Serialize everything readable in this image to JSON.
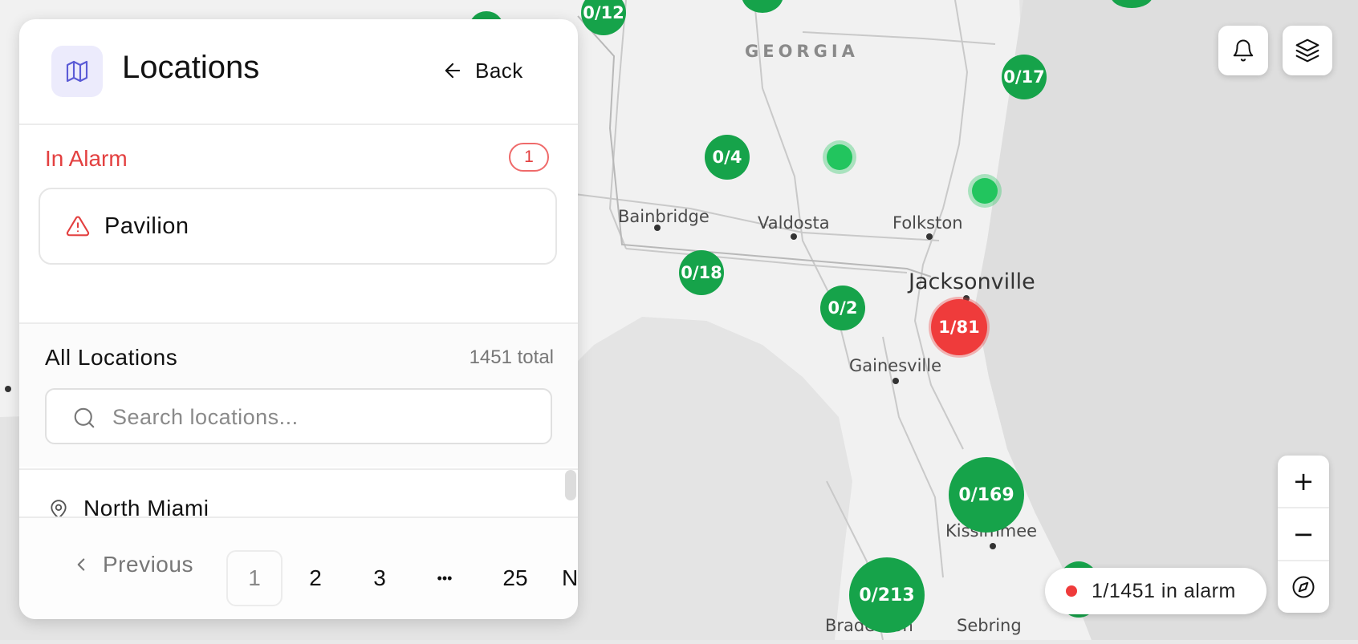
{
  "map": {
    "state_label": "GEORGIA",
    "cities": [
      {
        "name": "Bainbridge",
        "size": "small"
      },
      {
        "name": "Valdosta",
        "size": "small"
      },
      {
        "name": "Folkston",
        "size": "small"
      },
      {
        "name": "Jacksonville",
        "size": "big"
      },
      {
        "name": "Gainesville",
        "size": "small"
      },
      {
        "name": "Kissimmee",
        "size": "small"
      },
      {
        "name": "Sebring",
        "size": "small"
      },
      {
        "name": "Bradenton",
        "size": "small"
      }
    ],
    "clusters": [
      "0/12",
      "0/17",
      "0/4",
      "0/18",
      "0/2",
      "1/81",
      "0/169",
      "0/213"
    ],
    "colors": {
      "ok": "#16a34a",
      "alarm": "#ef3b3b"
    }
  },
  "panel": {
    "title": "Locations",
    "back_label": "Back",
    "map_icon": "map-icon",
    "in_alarm": {
      "heading": "In Alarm",
      "count": "1",
      "items": [
        {
          "label": "Pavilion",
          "icon": "alert-triangle-icon"
        }
      ]
    },
    "all_locations": {
      "heading": "All Locations",
      "total": "1451 total",
      "search_placeholder": "Search locations...",
      "items": [
        {
          "label": "North Miami",
          "icon": "map-pin-icon"
        }
      ]
    },
    "pagination": {
      "previous_label": "Previous",
      "pages": [
        "1",
        "2",
        "3",
        "•••",
        "25"
      ],
      "current_page": "1",
      "next_label": "N"
    }
  },
  "controls": {
    "notifications_icon": "bell-icon",
    "layers_icon": "layers-icon",
    "zoom_in": "+",
    "zoom_out": "−",
    "compass_icon": "compass-icon",
    "alarm_summary": "1/1451 in alarm"
  }
}
